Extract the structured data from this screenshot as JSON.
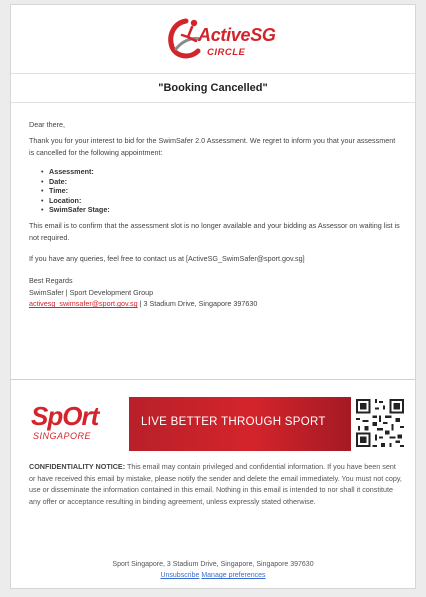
{
  "brand": {
    "name": "ActiveSG",
    "sub": "CIRCLE",
    "accent": "#d4242b"
  },
  "title": "\"Booking Cancelled\"",
  "greeting": "Dear there,",
  "intro": "Thank you for your interest to bid for the SwimSafer 2.0 Assessment. We regret to inform you that your assessment is cancelled for the following appointment:",
  "details": [
    "Assessment:",
    "Date:",
    "Time:",
    "Location:",
    "SwimSafer Stage:"
  ],
  "confirm": "This email is to confirm that the assessment slot is no longer available and your bidding as Assessor on waiting list is not required.",
  "query": "If you have any queries, feel free to contact us at [ActiveSG_SwimSafer@sport.gov.sg]",
  "signature": {
    "regards": "Best Regards",
    "org": "SwimSafer | Sport Development Group",
    "email_link": "activesg_swimsafer@sport.gov.sg",
    "address": " | 3 Stadium Drive, Singapore 397630"
  },
  "banner": {
    "logo_word": "SpOrt",
    "logo_sub": "SINGAPORE",
    "tagline": "LIVE BETTER THROUGH SPORT",
    "band_color": "#c41f29"
  },
  "notice": {
    "head": "CONFIDENTIALITY NOTICE:",
    "body": " This email may contain privileged and confidential information. If you have been sent or have received this email by mistake, please notify the sender and delete the email immediately. You must not copy, use or disseminate the information contained in this email. Nothing in this email is intended to nor shall it constitute any offer or acceptance resulting in binding agreement, unless expressly stated otherwise."
  },
  "footer": {
    "address": "Sport Singapore, 3 Stadium Drive, Singapore, Singapore 397630",
    "unsubscribe": "Unsubscribe",
    "manage": "Manage preferences"
  }
}
